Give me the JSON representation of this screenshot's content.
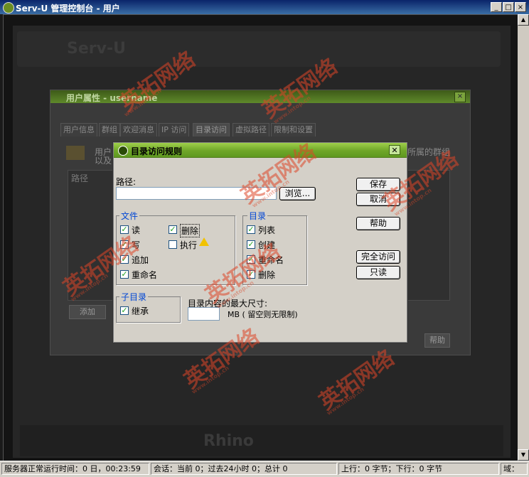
{
  "window": {
    "title": "Serv-U 管理控制台 - 用户",
    "min": "_",
    "max": "□",
    "close": "×"
  },
  "background": {
    "logo": "Serv-U",
    "rhino": "Rhino"
  },
  "user_dialog": {
    "title": "用户属性 - username",
    "tabs": [
      "用户信息",
      "群组",
      "欢迎消息",
      "IP 访问",
      "目录访问",
      "虚拟路径",
      "限制和设置"
    ],
    "text_1": "用户",
    "text_2": "以及",
    "text_right": "所属的群组",
    "column_path": "路径",
    "add_button": "添加",
    "help_button": "帮助"
  },
  "dialog": {
    "title": "目录访问规则",
    "path_label": "路径:",
    "path_value": "",
    "browse_button": "浏览...",
    "save_button": "保存",
    "cancel_button": "取消",
    "help_button": "帮助",
    "full_access_button": "完全访问",
    "read_only_button": "只读",
    "files_group": {
      "label": "文件",
      "items": [
        {
          "label": "读",
          "checked": true
        },
        {
          "label": "写",
          "checked": true
        },
        {
          "label": "追加",
          "checked": true
        },
        {
          "label": "重命名",
          "checked": true
        },
        {
          "label": "删除",
          "checked": true
        },
        {
          "label": "执行",
          "checked": false
        }
      ]
    },
    "dirs_group": {
      "label": "目录",
      "items": [
        {
          "label": "列表",
          "checked": true
        },
        {
          "label": "创建",
          "checked": true
        },
        {
          "label": "重命名",
          "checked": true
        },
        {
          "label": "删除",
          "checked": true
        }
      ]
    },
    "subdir_group": {
      "label": "子目录",
      "inherit_label": "继承",
      "inherit_checked": true
    },
    "max_size_label": "目录内容的最大尺寸:",
    "max_size_value": "",
    "max_size_unit": "MB ( 留空则无限制)"
  },
  "status_bar": {
    "uptime": "服务器正常运行时间：0 日，00:23:59",
    "sessions": "会话：当前 0；过去24小时 0；总计 0",
    "transfer": "上行：0 字节；下行：0 字节",
    "domain": "域："
  },
  "watermark": {
    "text": "英拓网络",
    "small": "www.intop.cn"
  }
}
